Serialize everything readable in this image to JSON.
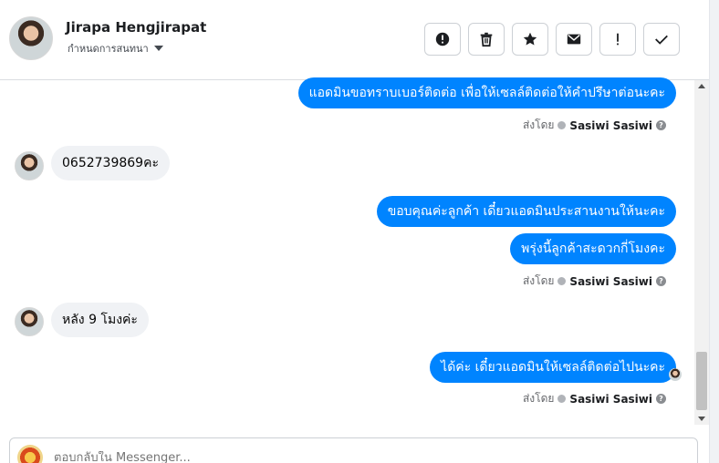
{
  "header": {
    "contact_name": "Jirapa Hengjirapat",
    "conversation_settings": "กำหนดการสนทนา",
    "toolbar": [
      {
        "name": "report-icon"
      },
      {
        "name": "trash-icon"
      },
      {
        "name": "star-icon"
      },
      {
        "name": "mail-icon"
      },
      {
        "name": "important-icon"
      },
      {
        "name": "check-icon"
      }
    ]
  },
  "messages": {
    "m1": "แอดมินขอทราบเบอร์ติดต่อ เพื่อให้เซลล์ติดต่อให้คำปรึษาต่อนะคะ",
    "m2": "0652739869คะ",
    "m3": "ขอบคุณค่ะลูกค้า เดี๋ยวแอดมินประสานงานให้นะคะ",
    "m4": "พรุ่งนี้ลูกค้าสะดวกกี่โมงคะ",
    "m5": "หลัง 9 โมงค่ะ",
    "m6": "ได้ค่ะ เดี๋ยวแอดมินให้เซลล์ติดต่อไปนะคะ"
  },
  "sent_by": {
    "prefix": "ส่งโดย",
    "name": "Sasiwi Sasiwi",
    "help": "?"
  },
  "composer": {
    "placeholder": "ตอบกลับใน Messenger..."
  },
  "colors": {
    "outgoing_bubble": "#0084ff",
    "incoming_bubble": "#f0f2f5"
  }
}
